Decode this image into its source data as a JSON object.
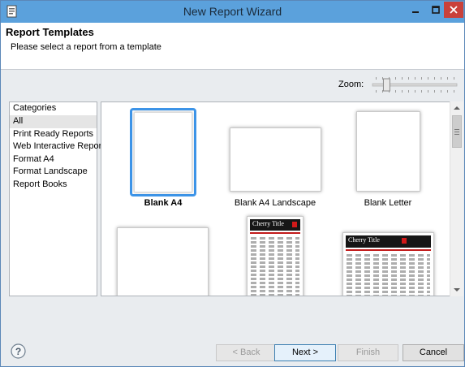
{
  "window": {
    "title": "New Report Wizard"
  },
  "header": {
    "title": "Report Templates",
    "description": "Please select a report from a template"
  },
  "zoom": {
    "label": "Zoom:",
    "level": 0.14
  },
  "categories": {
    "header": "Categories",
    "items": [
      {
        "label": "All",
        "selected": true
      },
      {
        "label": "Print Ready Reports",
        "selected": false
      },
      {
        "label": "Web Interactive Reports",
        "selected": false
      },
      {
        "label": "Format A4",
        "selected": false
      },
      {
        "label": "Format Landscape",
        "selected": false
      },
      {
        "label": "Report Books",
        "selected": false
      }
    ]
  },
  "templates": [
    {
      "label": "Blank A4",
      "selected": true
    },
    {
      "label": "Blank A4 Landscape",
      "selected": false
    },
    {
      "label": "Blank Letter",
      "selected": false
    },
    {
      "label": "",
      "selected": false
    },
    {
      "label": "",
      "selected": false,
      "preview_title": "Cherry Title"
    },
    {
      "label": "",
      "selected": false,
      "preview_title": "Cherry Title"
    }
  ],
  "buttons": {
    "back": "< Back",
    "next": "Next >",
    "finish": "Finish",
    "cancel": "Cancel"
  },
  "icons": {
    "app": "report-wizard-icon",
    "help": "help-icon",
    "minimize": "minimize-icon",
    "maximize": "maximize-icon",
    "close": "close-icon"
  },
  "colors": {
    "titlebar": "#5ba1dc",
    "close_button": "#c9413a",
    "selection": "#3d94e8",
    "cherry_red": "#c21a1a"
  }
}
